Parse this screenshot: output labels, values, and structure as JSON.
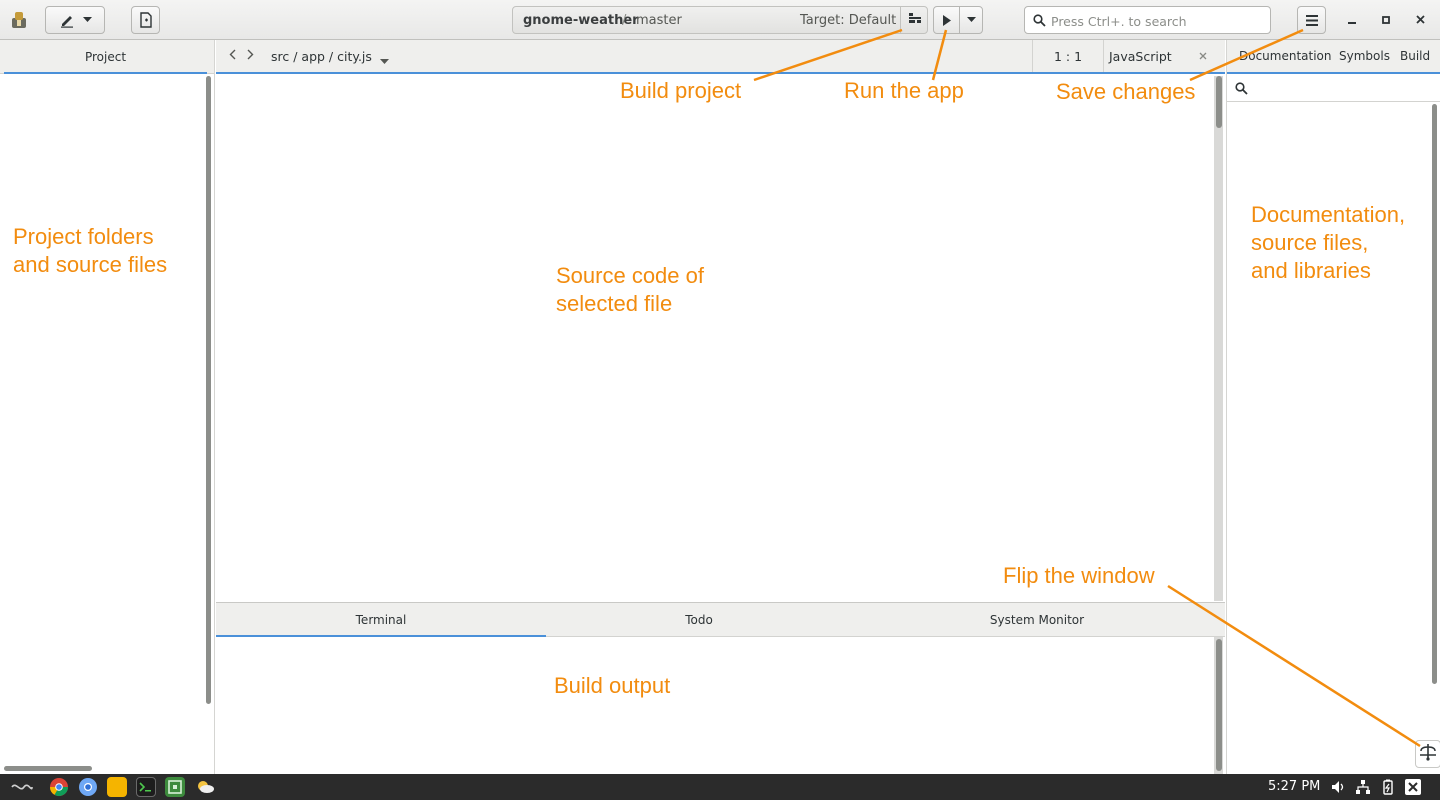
{
  "header": {
    "project_name": "gnome-weather",
    "branch_separator": "/",
    "branch": "master",
    "target": "Target: Default",
    "search_placeholder": "Press Ctrl+. to search"
  },
  "left_panel": {
    "tab_label": "Project"
  },
  "editor": {
    "file_path": "src / app / city.js",
    "cursor_position": "1 : 1",
    "language": "JavaScript"
  },
  "bottom_panel": {
    "tabs": [
      "Terminal",
      "Todo",
      "System Monitor"
    ]
  },
  "right_panel": {
    "tabs": [
      "Documentation",
      "Symbols",
      "Build"
    ]
  },
  "annotations": {
    "build_project": "Build project",
    "run_app": "Run the app",
    "save_changes": "Save changes",
    "project_folders_line1": "Project folders",
    "project_folders_line2": "and source files",
    "source_code_line1": "Source code of",
    "source_code_line2": "selected file",
    "documentation_line1": "Documentation,",
    "documentation_line2": "source files,",
    "documentation_line3": "and libraries",
    "flip_window": "Flip the window",
    "build_output": "Build output",
    "color": "#f28c0f"
  },
  "taskbar": {
    "clock": "5:27 PM"
  },
  "icons": {
    "header": [
      "app-logo-icon",
      "pencil-icon",
      "chevron-down-icon",
      "new-document-icon",
      "build-icon",
      "play-icon",
      "search-icon",
      "hamburger-menu-icon",
      "minimize-icon",
      "maximize-icon",
      "close-icon"
    ],
    "taskbar": [
      "launcher-icon",
      "chrome-icon",
      "chromium-icon",
      "files-icon",
      "terminal-icon",
      "builder-icon",
      "weather-icon",
      "volume-icon",
      "network-icon",
      "battery-icon",
      "notifications-icon"
    ]
  }
}
